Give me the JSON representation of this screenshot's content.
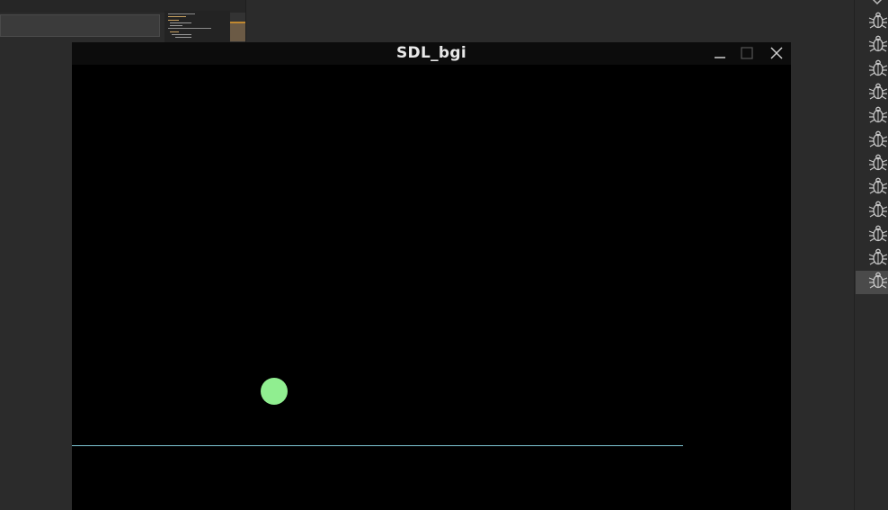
{
  "window": {
    "title": "SDL_bgi",
    "controls": [
      "minimize",
      "maximize",
      "close"
    ]
  },
  "scene": {
    "ball_color": "#90ee90",
    "line_color": "#7fc6d4",
    "background": "#000000"
  },
  "debug_panel": {
    "icon": "bug-icon",
    "count": 12,
    "selected_index": 11
  }
}
